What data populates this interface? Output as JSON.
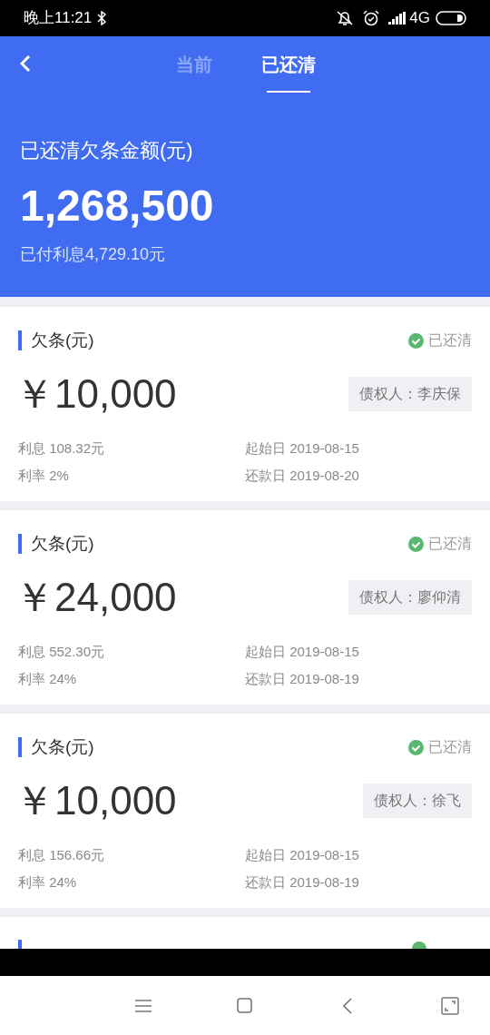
{
  "status_bar": {
    "time": "晚上11:21",
    "network": "4G"
  },
  "tabs": [
    {
      "label": "当前",
      "selected": false
    },
    {
      "label": "已还清",
      "selected": true
    }
  ],
  "summary": {
    "label": "已还清欠条金额(元)",
    "amount": "1,268,500",
    "interest": "已付利息4,729.10元"
  },
  "cards": [
    {
      "title": "欠条(元)",
      "status": "已还清",
      "amount": "￥10,000",
      "creditor": "债权人：李庆保",
      "interest": "利息 108.32元",
      "rate": "利率 2%",
      "start": "起始日 2019-08-15",
      "due": "还款日 2019-08-20"
    },
    {
      "title": "欠条(元)",
      "status": "已还清",
      "amount": "￥24,000",
      "creditor": "债权人：廖仰清",
      "interest": "利息 552.30元",
      "rate": "利率 24%",
      "start": "起始日 2019-08-15",
      "due": "还款日 2019-08-19"
    },
    {
      "title": "欠条(元)",
      "status": "已还清",
      "amount": "￥10,000",
      "creditor": "债权人：徐飞",
      "interest": "利息 156.66元",
      "rate": "利率 24%",
      "start": "起始日 2019-08-15",
      "due": "还款日 2019-08-19"
    }
  ]
}
